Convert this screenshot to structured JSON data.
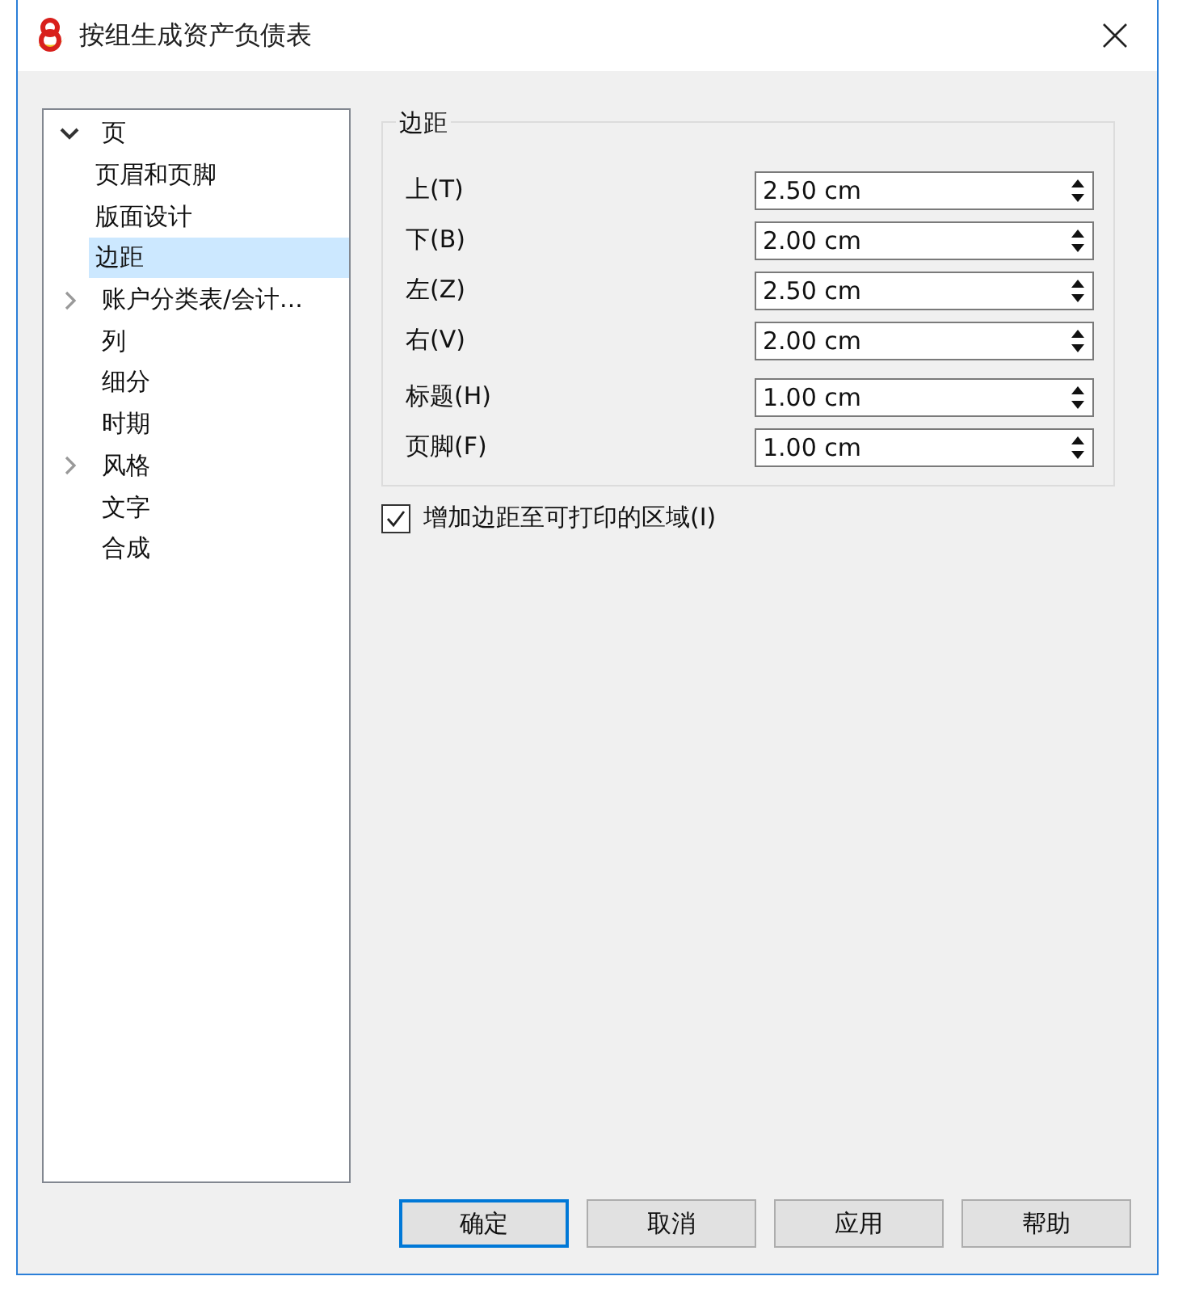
{
  "window": {
    "title": "按组生成资产负债表"
  },
  "tree": [
    {
      "label": "页",
      "expanded": true,
      "selected": false,
      "children": [
        {
          "label": "页眉和页脚",
          "selected": false
        },
        {
          "label": "版面设计",
          "selected": false
        },
        {
          "label": "边距",
          "selected": true
        }
      ]
    },
    {
      "label": "账户分类表/会计...",
      "expanded": false,
      "selected": false
    },
    {
      "label": "列",
      "selected": false
    },
    {
      "label": "细分",
      "selected": false
    },
    {
      "label": "时期",
      "selected": false
    },
    {
      "label": "风格",
      "expanded": false,
      "selected": false
    },
    {
      "label": "文字",
      "selected": false
    },
    {
      "label": "合成",
      "selected": false
    }
  ],
  "group": {
    "title": "边距",
    "field_groups": [
      {
        "fields": [
          {
            "label": "上(T)",
            "value": "2.50 cm"
          },
          {
            "label": "下(B)",
            "value": "2.00 cm"
          },
          {
            "label": "左(Z)",
            "value": "2.50 cm"
          },
          {
            "label": "右(V)",
            "value": "2.00 cm"
          }
        ]
      },
      {
        "fields": [
          {
            "label": "标题(H)",
            "value": "1.00 cm"
          },
          {
            "label": "页脚(F)",
            "value": "1.00 cm"
          }
        ]
      }
    ]
  },
  "checkbox": {
    "label": "增加边距至可打印的区域(I)",
    "checked": true
  },
  "buttons": [
    {
      "label": "确定",
      "default": true
    },
    {
      "label": "取消",
      "default": false
    },
    {
      "label": "应用",
      "default": false
    },
    {
      "label": "帮助",
      "default": false
    }
  ]
}
